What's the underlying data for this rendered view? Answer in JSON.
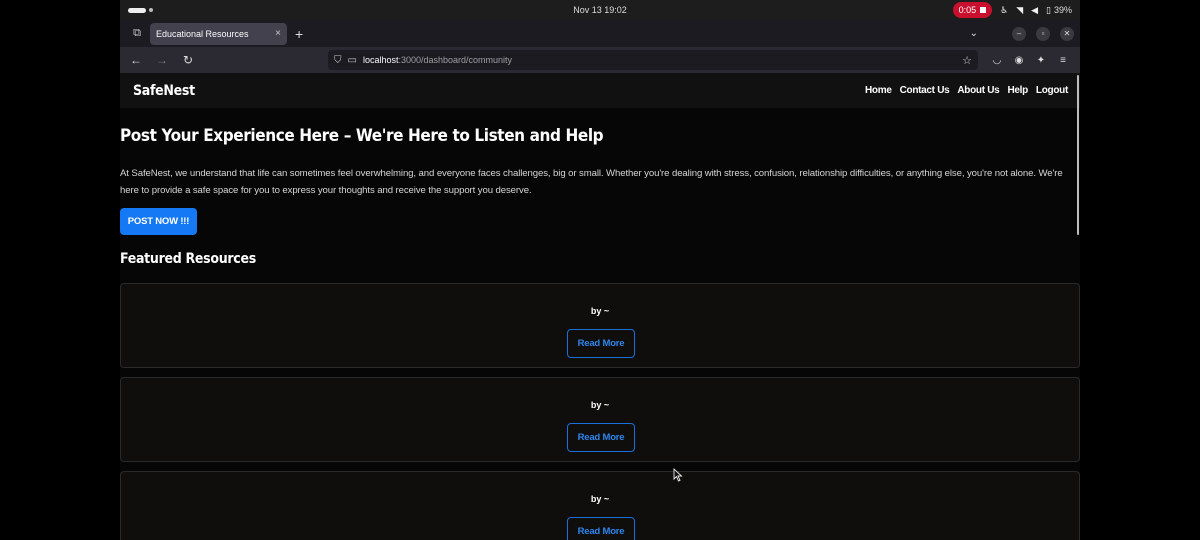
{
  "os": {
    "clock": "Nov 13  19:02",
    "recording_time": "0:05",
    "battery": "39%"
  },
  "browser": {
    "tab_title": "Educational Resources",
    "url_host": "localhost",
    "url_path": ":3000/dashboard/community"
  },
  "site": {
    "brand": "SafeNest",
    "nav": [
      "Home",
      "Contact Us",
      "About Us",
      "Help",
      "Logout"
    ]
  },
  "hero": {
    "title": "Post Your Experience Here – We're Here to Listen and Help",
    "text": "At SafeNest, we understand that life can sometimes feel overwhelming, and everyone faces challenges, big or small. Whether you're dealing with stress, confusion, relationship difficulties, or anything else, you're not alone. We're here to provide a safe space for you to express your thoughts and receive the support you deserve.",
    "button": "POST NOW !!!"
  },
  "resources": {
    "title": "Featured Resources",
    "cards": [
      {
        "byline": "by ~",
        "button": "Read More"
      },
      {
        "byline": "by ~",
        "button": "Read More"
      },
      {
        "byline": "by ~",
        "button": "Read More"
      }
    ]
  }
}
